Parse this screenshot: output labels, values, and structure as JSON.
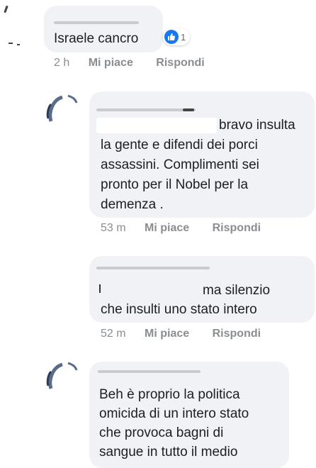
{
  "comments": [
    {
      "text": "Israele cancro",
      "reaction_count": "1",
      "reaction_icon": "thumbs-up-icon",
      "time": "2 h",
      "like_label": "Mi piace",
      "reply_label": "Rispondi"
    },
    {
      "text_lines": [
        "bravo insulta",
        "la gente e difendi dei porci",
        "assassini. Complimenti sei",
        "pronto per il Nobel per la",
        "demenza ."
      ],
      "time": "53 m",
      "like_label": "Mi piace",
      "reply_label": "Rispondi"
    },
    {
      "text_lines": [
        "ma silenzio",
        "che insulti uno stato intero"
      ],
      "time": "52 m",
      "like_label": "Mi piace",
      "reply_label": "Rispondi"
    },
    {
      "text_lines": [
        "Beh è proprio la politica",
        "omicida di un intero stato",
        "che provoca bagni di",
        "sangue in tutto il medio"
      ]
    }
  ],
  "colors": {
    "bubble": "#f0f2f5",
    "text": "#1c1e21",
    "meta": "#8a8d91",
    "like_blue": "#1877f2"
  }
}
